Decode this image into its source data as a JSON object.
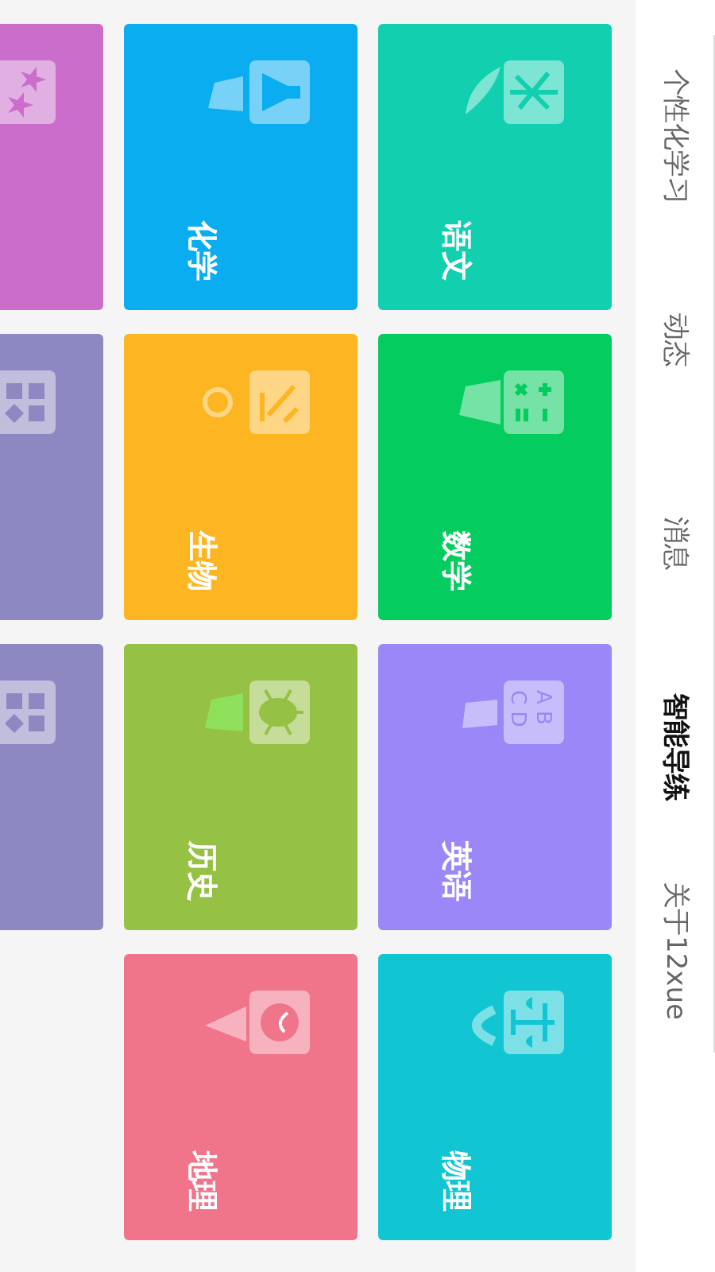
{
  "nav": {
    "tabs": [
      {
        "label": "个性化学习",
        "selected": false
      },
      {
        "label": "动态",
        "selected": false
      },
      {
        "label": "消息",
        "selected": false
      },
      {
        "label": "智能导练",
        "selected": true
      },
      {
        "label": "关于12xue",
        "selected": false
      }
    ]
  },
  "tiles": [
    {
      "label": "语文",
      "color": "#12cfb0",
      "kind": "chinese"
    },
    {
      "label": "数学",
      "color": "#05cc5e",
      "kind": "math"
    },
    {
      "label": "英语",
      "color": "#9b87f7",
      "kind": "english",
      "icon_lines": [
        "A B",
        "C D"
      ]
    },
    {
      "label": "物理",
      "color": "#11c6d2",
      "kind": "physics"
    },
    {
      "label": "化学",
      "color": "#0aaef0",
      "kind": "chemistry"
    },
    {
      "label": "生物",
      "color": "#fdb521",
      "kind": "biology"
    },
    {
      "label": "历史",
      "color": "#95c145",
      "kind": "history"
    },
    {
      "label": "地理",
      "color": "#f0748a",
      "kind": "geography"
    },
    {
      "color": "#cb6ecb",
      "kind": "stars"
    },
    {
      "color": "#8e88c2",
      "kind": "shapes"
    },
    {
      "color": "#8e88c2",
      "kind": "shapes"
    }
  ]
}
